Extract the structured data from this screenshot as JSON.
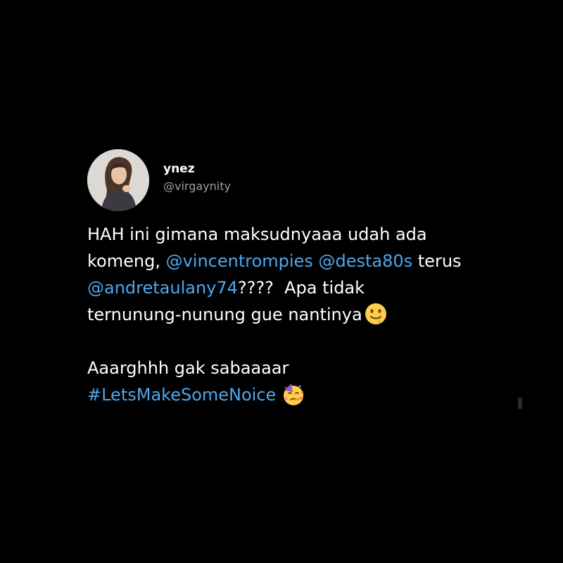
{
  "tweet": {
    "author": {
      "display_name": "ynez",
      "handle": "@virgaynity",
      "avatar_icon": "profile-photo"
    },
    "body": {
      "line1": "HAH ini gimana maksudnyaaa udah ada",
      "line2_text": "komeng, ",
      "mention1": "@vincentrompies",
      "space": " ",
      "mention2": "@desta80s",
      "line2_tail": " terus",
      "mention3": "@andretaulany74",
      "line3_tail": "????  Apa tidak",
      "line4": "ternunung-nunung gue nantinya",
      "line4_emoji": "drooling-face-emoji",
      "line5": "Aaarghhh gak sabaaaar",
      "hashtag": "#LetsMakeSomeNoice",
      "hashtag_emoji": "partying-face-emoji"
    },
    "colors": {
      "background": "#000000",
      "text": "#ffffff",
      "link": "#4ea7ee",
      "handle": "#9aa0a5"
    }
  }
}
